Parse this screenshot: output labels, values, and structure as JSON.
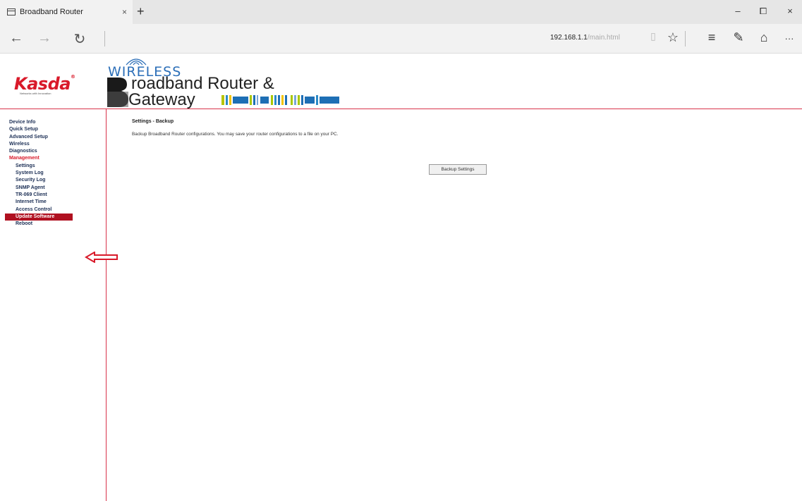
{
  "browser": {
    "tab_title": "Broadband Router",
    "tab_close": "×",
    "new_tab": "+",
    "window_controls": {
      "minimize": "–",
      "maximize": "⧠",
      "close": "×"
    },
    "nav": {
      "back": "←",
      "forward": "→",
      "refresh": "↻"
    },
    "url": {
      "host": "192.168.1.1",
      "path": "/main.html"
    },
    "toolbar": {
      "reading": "▯",
      "favorite": "☆",
      "hub": "≡",
      "notes": "✎",
      "share": "⌂",
      "more": "···"
    }
  },
  "router": {
    "logo": {
      "brand": "Kasda",
      "tagline": "Networks with Innovation",
      "brand_color": "#d91a2a"
    },
    "header": {
      "wireless": "WIRELESS",
      "line1": "roadband Router &",
      "line2": "Gateway",
      "big_letter": "B"
    },
    "menu": {
      "items": [
        {
          "label": "Device Info"
        },
        {
          "label": "Quick Setup"
        },
        {
          "label": "Advanced Setup"
        },
        {
          "label": "Wireless"
        },
        {
          "label": "Diagnostics"
        },
        {
          "label": "Management"
        },
        {
          "label": "Settings"
        },
        {
          "label": "System Log"
        },
        {
          "label": "Security Log"
        },
        {
          "label": "SNMP Agent"
        },
        {
          "label": "TR-069 Client"
        },
        {
          "label": "Internet Time"
        },
        {
          "label": "Access Control"
        },
        {
          "label": "Update Software"
        },
        {
          "label": "Reboot"
        }
      ]
    },
    "content": {
      "title": "Settings - Backup",
      "description": "Backup Broadband Router configurations. You may save your router configurations to a file on your PC.",
      "button": "Backup Settings"
    },
    "accent_color": "#d9334a"
  }
}
